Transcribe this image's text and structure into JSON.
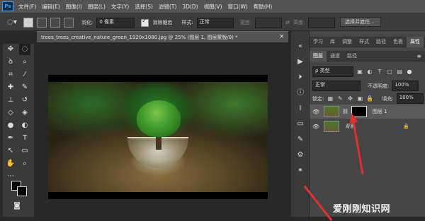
{
  "menubar": {
    "logo": "Ps",
    "items": [
      "文件(F)",
      "编辑(E)",
      "图像(I)",
      "图层(L)",
      "文字(Y)",
      "选择(S)",
      "滤镜(T)",
      "3D(D)",
      "视图(V)",
      "窗口(W)",
      "帮助(H)"
    ]
  },
  "options": {
    "feather_label": "羽化:",
    "feather_value": "0 像素",
    "antialias_label": "消除锯齿",
    "style_label": "样式:",
    "style_value": "正常",
    "width_label": "宽度:",
    "height_label": "高度:",
    "select_mask_label": "选择并遮住..."
  },
  "document": {
    "tab_title": "trees_trees_creative_nature_green_1920x1080.jpg @ 25% (图层 1, 图层蒙版/8) *",
    "close_symbol": "×"
  },
  "panel": {
    "top_tabs": [
      "学习",
      "库",
      "调整",
      "样式",
      "路径",
      "色板",
      "属性"
    ],
    "layer_tabs": [
      "图层",
      "通道",
      "路径"
    ],
    "filter_label": "ρ 类型",
    "blend_mode": "正常",
    "opacity_label": "不透明度:",
    "opacity_value": "100%",
    "lock_label": "锁定:",
    "fill_label": "填充:",
    "fill_value": "100%",
    "layers": [
      {
        "name": "图层 1"
      },
      {
        "name": "背景"
      }
    ]
  },
  "watermark": "爱刚刚知识网",
  "colors": {
    "accent": "#31a8ff",
    "arrow": "#e03030"
  }
}
